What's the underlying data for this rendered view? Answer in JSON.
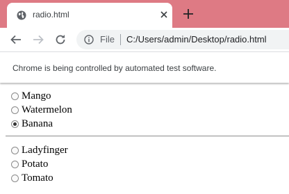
{
  "tab": {
    "title": "radio.html"
  },
  "omnibox": {
    "scheme_label": "File",
    "url": "C:/Users/admin/Desktop/radio.html"
  },
  "infobar": {
    "message": "Chrome is being controlled by automated test software."
  },
  "group1": [
    {
      "label": "Mango",
      "checked": false
    },
    {
      "label": "Watermelon",
      "checked": false
    },
    {
      "label": "Banana",
      "checked": true
    }
  ],
  "group2": [
    {
      "label": "Ladyfinger",
      "checked": false
    },
    {
      "label": "Potato",
      "checked": false
    },
    {
      "label": "Tomato",
      "checked": false
    }
  ],
  "colors": {
    "tabstrip": "#de7a84",
    "omnibox_bg": "#f1f3f4"
  }
}
